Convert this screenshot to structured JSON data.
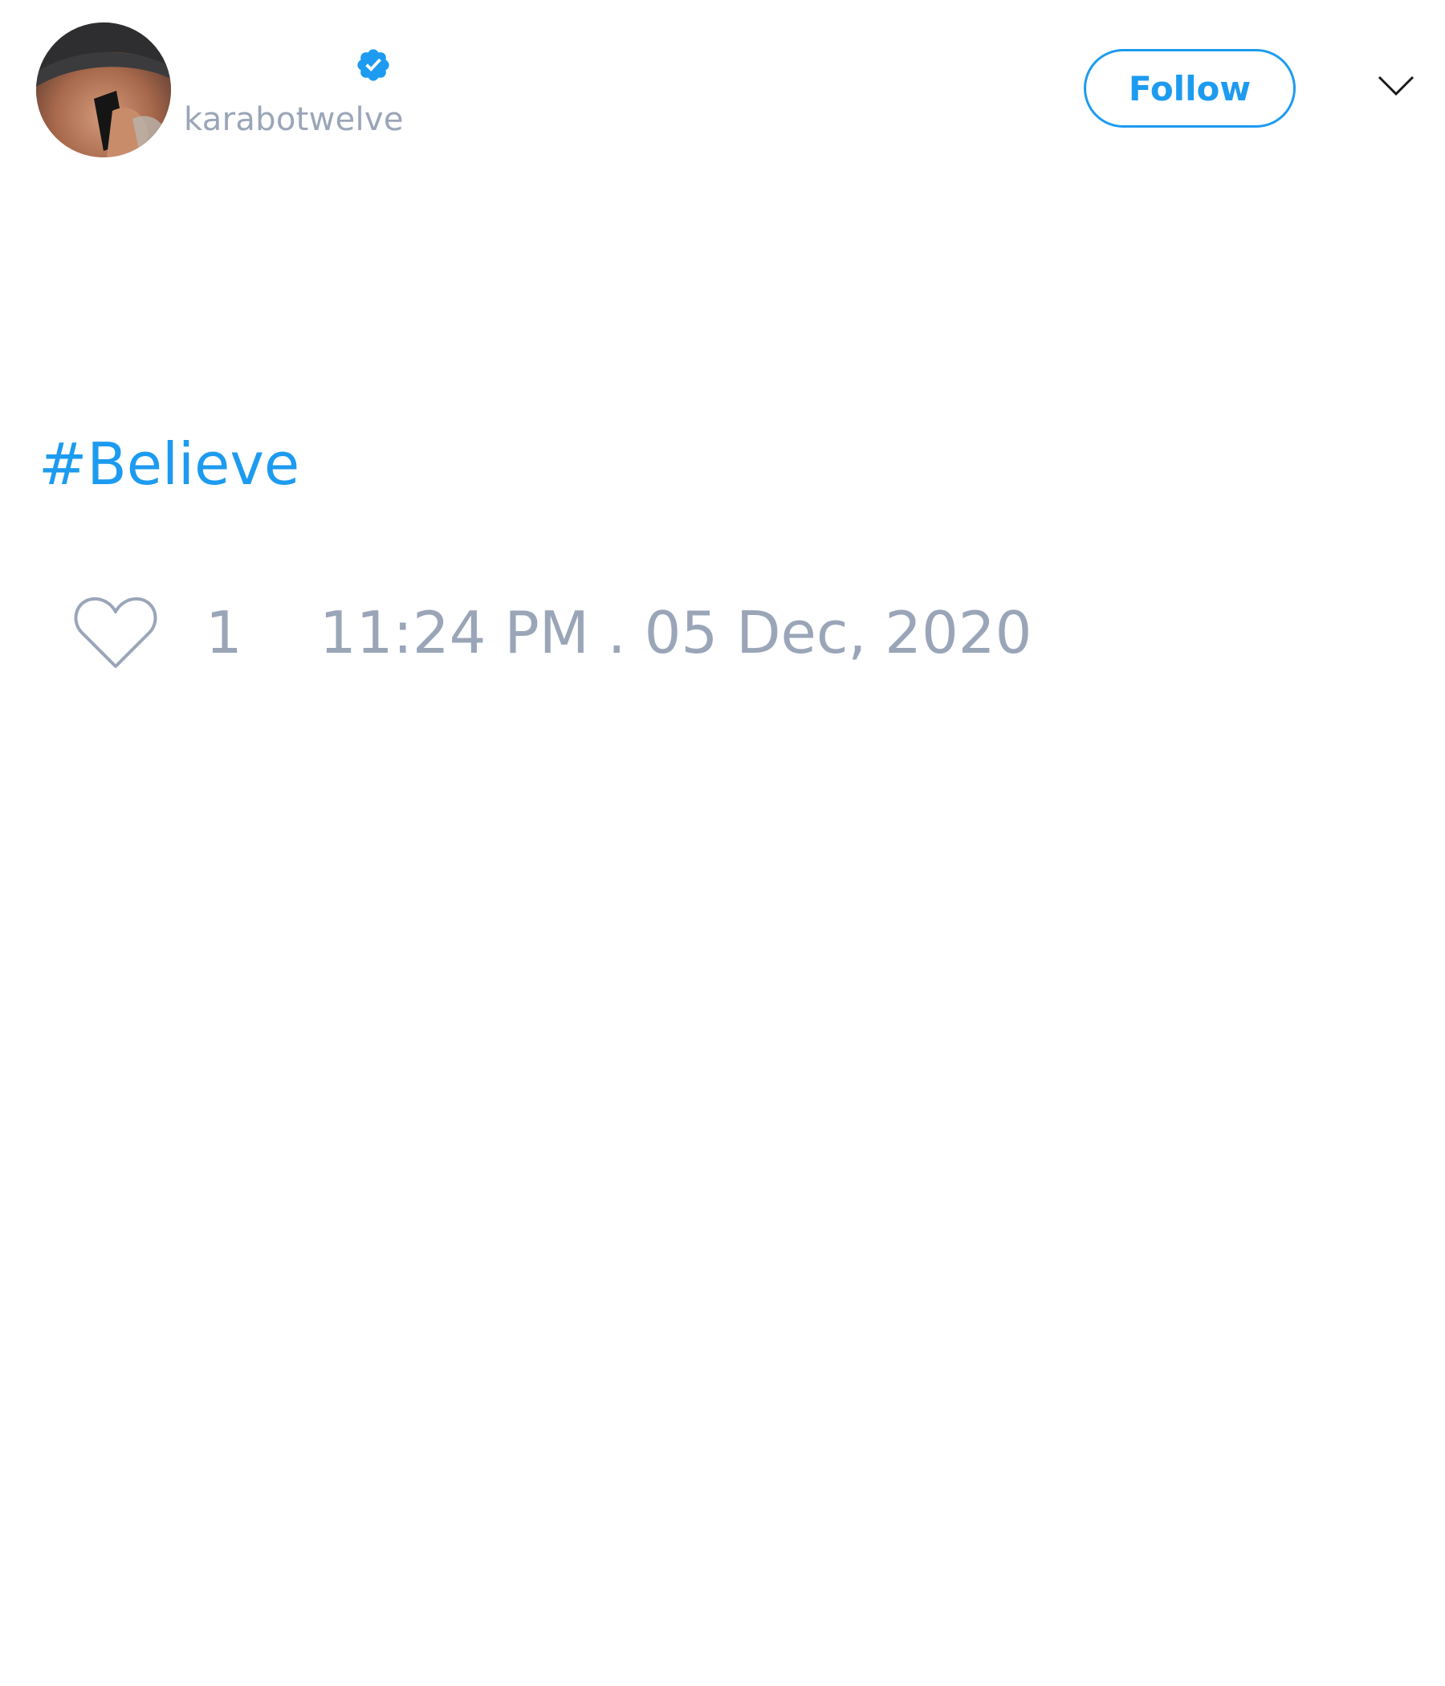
{
  "user": {
    "handle": "karabotwelve",
    "verified": true,
    "avatar_icon": "profile-photo"
  },
  "header": {
    "follow_label": "Follow",
    "menu_icon": "chevron-down-icon"
  },
  "tweet": {
    "text": "#Believe"
  },
  "stats": {
    "like_icon": "heart-icon",
    "like_count": "1",
    "timestamp": "11:24 PM . 05 Dec, 2020"
  },
  "colors": {
    "accent": "#1d9bf0",
    "muted_text": "#9aa5b8",
    "background": "#ffffff"
  }
}
